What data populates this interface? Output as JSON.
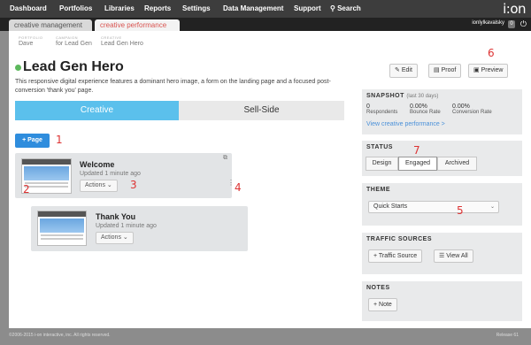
{
  "nav": {
    "items": [
      "Dashboard",
      "Portfolios",
      "Libraries",
      "Reports",
      "Settings",
      "Data Management",
      "Support"
    ],
    "search_label": "Search",
    "logo_text": "i:on"
  },
  "tabs": {
    "inactive": "creative management",
    "active": "creative performance"
  },
  "user": {
    "name": "ionlylkavalsky",
    "badge": "0"
  },
  "breadcrumb": [
    {
      "label": "Portfolio",
      "value": "Dave"
    },
    {
      "label": "Campaign",
      "value": "for Lead Gen"
    },
    {
      "label": "Creative",
      "value": "Lead Gen Hero"
    }
  ],
  "page": {
    "title": "Lead Gen Hero",
    "description": "This responsive digital experience features a dominant hero image, a form on the landing page and a focused post-conversion 'thank you' page.",
    "status_color": "#5cb85c"
  },
  "view_toggle": {
    "creative": "Creative",
    "sell_side": "Sell-Side"
  },
  "add_page_label": "+ Page",
  "pages": [
    {
      "title": "Welcome",
      "updated": "Updated 1 minute ago",
      "actions": "Actions ⌄"
    },
    {
      "title": "Thank You",
      "updated": "Updated 1 minute ago",
      "actions": "Actions ⌄"
    }
  ],
  "toolbar": {
    "edit": "Edit",
    "proof": "Proof",
    "preview": "Preview"
  },
  "snapshot": {
    "title": "SNAPSHOT",
    "range": "(last 30 days)",
    "metrics": [
      {
        "value": "0",
        "label": "Respondents"
      },
      {
        "value": "0.00%",
        "label": "Bounce Rate"
      },
      {
        "value": "0.00%",
        "label": "Conversion Rate"
      }
    ],
    "link": "View creative performance >"
  },
  "status": {
    "title": "STATUS",
    "options": [
      "Design",
      "Engaged",
      "Archived"
    ],
    "selected": "Engaged"
  },
  "theme": {
    "title": "THEME",
    "value": "Quick Starts"
  },
  "traffic": {
    "title": "TRAFFIC SOURCES",
    "add": "+ Traffic Source",
    "view_all": "View All"
  },
  "notes": {
    "title": "NOTES",
    "add": "+ Note"
  },
  "annotations": [
    "1",
    "2",
    "3",
    "4",
    "5",
    "6",
    "7"
  ],
  "footer": {
    "copyright": "©2006-2015 i-on interactive, inc. All rights reserved.",
    "release": "Release 61"
  },
  "colors": {
    "accent_blue": "#2f8ddd",
    "tab_active_text": "#d9534f",
    "annotation_red": "#dd3333",
    "link_blue": "#4a90d9"
  }
}
